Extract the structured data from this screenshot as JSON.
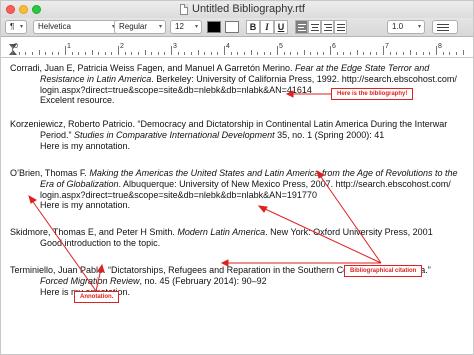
{
  "window": {
    "title": "Untitled Bibliography.rtf"
  },
  "toolbar": {
    "paragraph_style": "¶",
    "font_family": "Helvetica",
    "font_style": "Regular",
    "font_size": "12",
    "line_spacing": "1.0",
    "bold_label": "B",
    "italic_label": "I",
    "underline_label": "U",
    "text_color": "#000000",
    "highlight_color": "#ffffff"
  },
  "ruler": {
    "numbers": [
      "0",
      "1",
      "2",
      "3",
      "4",
      "5",
      "6",
      "7",
      "8"
    ]
  },
  "entries": [
    {
      "l1a": "Corradi, Juan E, Patricia Weiss Fagen, and Manuel A Garretón Merino. ",
      "l1i": "Fear at the Edge State Terror and",
      "l2i": "Resistance in Latin America",
      "l2b": ". Berkeley: University of California Press, 1992. http://search.ebscohost.com/",
      "l3": "login.aspx?direct=true&scope=site&db=nlebk&db=nlabk&AN=41614",
      "note": "Excelent resource."
    },
    {
      "l1a": "Korzeniewicz, Roberto Patricio. “Democracy and Dictatorship in Continental Latin America During the Interwar",
      "l2a": "Period.” ",
      "l2i": "Studies in Comparative International Development",
      "l2b": " 35, no. 1 (Spring 2000): 41",
      "note": "Here is my annotation."
    },
    {
      "l1a": "O’Brien, Thomas F. ",
      "l1i": "Making the Americas the United States and Latin America from the Age of Revolutions to the",
      "l2i": "Era of Globalization",
      "l2b": ". Albuquerque: University of New Mexico Press, 2007. http://search.ebscohost.com/",
      "l3": "login.aspx?direct=true&scope=site&db=nlebk&db=nlabk&AN=191770",
      "note": "Here is my annotation."
    },
    {
      "l1a": "Skidmore, Thomas E, and Peter H Smith. ",
      "l1i": "Modern Latin America",
      "l1b": ". New York: Oxford University Press, 2001",
      "note": "Good introduction to the topic."
    },
    {
      "l1a": "Terminiello, Juan Pablo. “Dictatorships, Refugees and Reparation in the Southern Cone of Latin America.”",
      "l2i": "Forced Migration Review",
      "l2b": ", no. 45 (February 2014): 90–92",
      "note": "Here is my annotation."
    }
  ],
  "annotations": {
    "bibliography_label": "Here is the bibliography!",
    "citation_label": "Bibliographical citation",
    "annotation_label": "Annotation."
  },
  "colors": {
    "callout": "#dd2222"
  }
}
